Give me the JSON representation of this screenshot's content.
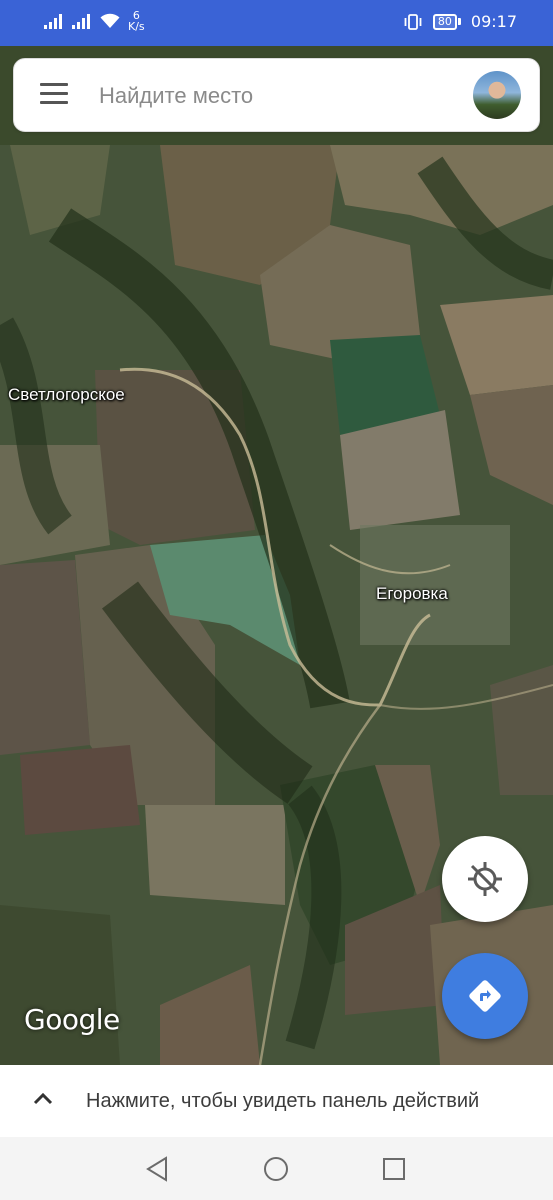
{
  "status_bar": {
    "net_speed_value": "6",
    "net_speed_unit": "K/s",
    "battery": "80",
    "time": "09:17",
    "icons": [
      "signal-icon",
      "signal-icon",
      "wifi-icon",
      "vibrate-icon",
      "battery-icon"
    ]
  },
  "search": {
    "placeholder": "Найдите место"
  },
  "map": {
    "labels": {
      "svetlogorskoe": "Светлогорское",
      "egorovka": "Егоровка"
    },
    "attribution": "Google"
  },
  "fabs": {
    "location_icon": "location-disabled-icon",
    "directions_icon": "directions-icon"
  },
  "bottom_sheet": {
    "text": "Нажмите, чтобы увидеть панель действий"
  },
  "nav": {
    "icons": [
      "back-icon",
      "home-icon",
      "recents-icon"
    ]
  },
  "colors": {
    "status_bar": "#3a63d6",
    "directions_fab": "#3f7de0",
    "location_fab": "#ffffff"
  }
}
